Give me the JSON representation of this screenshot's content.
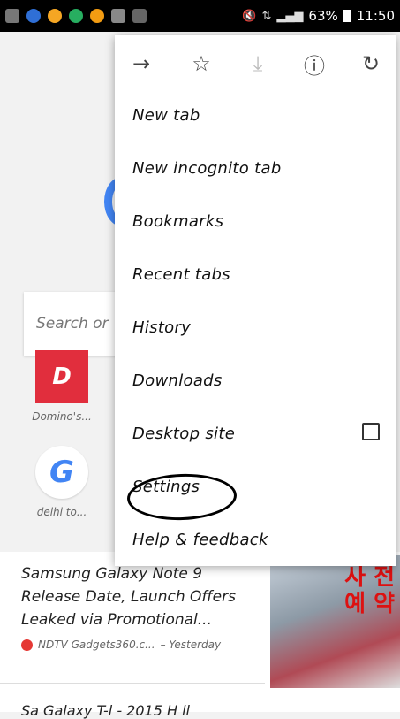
{
  "status_bar": {
    "battery": "63%",
    "time": "11:50"
  },
  "page": {
    "search_placeholder": "Search or",
    "tiles": [
      {
        "label": "Domino's...",
        "icon_letter": "D"
      },
      {
        "label": "delhi to...",
        "icon_letter": "G"
      }
    ],
    "news": {
      "title": "Samsung Galaxy Note 9 Release Date, Launch Offers Leaked via Promotional...",
      "source": "NDTV Gadgets360.c...",
      "time": "– Yesterday",
      "next_title": "Sa Galaxy T-l - 2015 H ll",
      "image_text": "사 전\n예 약"
    }
  },
  "menu": {
    "toolbar": [
      {
        "name": "forward-icon",
        "glyph": "→"
      },
      {
        "name": "star-icon",
        "glyph": "☆"
      },
      {
        "name": "download-icon",
        "glyph": "⤓"
      },
      {
        "name": "info-icon",
        "glyph": "ⓘ"
      },
      {
        "name": "reload-icon",
        "glyph": "↻"
      }
    ],
    "items": [
      {
        "label": "New tab"
      },
      {
        "label": "New incognito tab"
      },
      {
        "label": "Bookmarks"
      },
      {
        "label": "Recent tabs"
      },
      {
        "label": "History"
      },
      {
        "label": "Downloads"
      },
      {
        "label": "Desktop site"
      },
      {
        "label": "Settings"
      },
      {
        "label": "Help & feedback"
      }
    ]
  },
  "colors": {
    "status_bar_bg": "#000000",
    "accent_blue": "#4285f4",
    "dominos_red": "#e12e3d"
  }
}
